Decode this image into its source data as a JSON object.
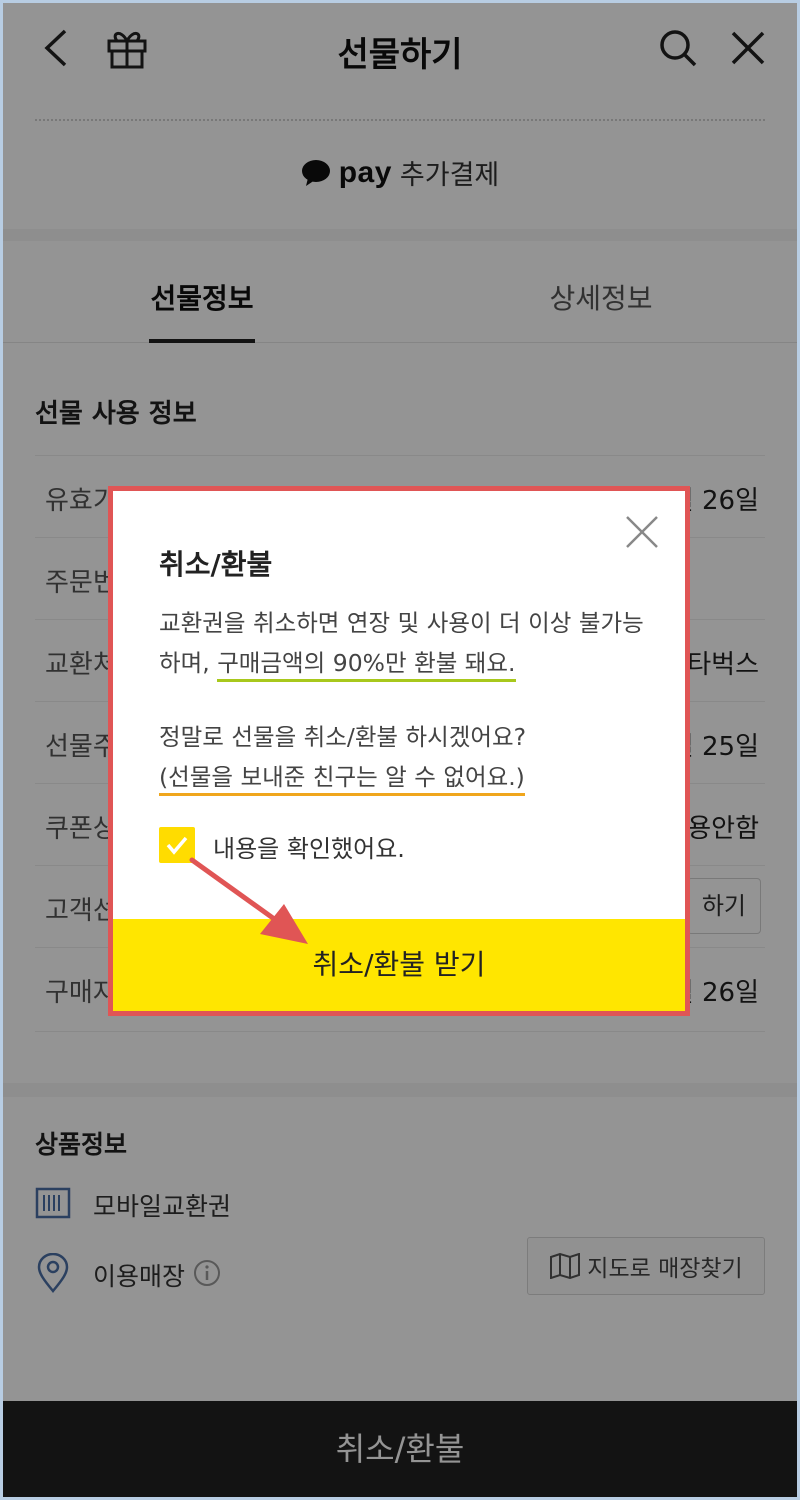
{
  "header": {
    "title": "선물하기",
    "icons": [
      "back-icon",
      "gift-icon",
      "search-icon",
      "close-icon"
    ]
  },
  "pay": {
    "logo": "pay",
    "label": "추가결제"
  },
  "tabs": [
    {
      "label": "선물정보",
      "active": true
    },
    {
      "label": "상세정보",
      "active": false
    }
  ],
  "usage_section": {
    "title": "선물 사용 정보",
    "rows": [
      {
        "label": "유효기",
        "value": "월 26일"
      },
      {
        "label": "주문번",
        "value": ""
      },
      {
        "label": "교환처",
        "value": "타벅스"
      },
      {
        "label": "선물주",
        "value": "일 25일"
      },
      {
        "label": "쿠폰상",
        "value": "용안함"
      },
      {
        "label": "고객선",
        "button": "하기"
      },
      {
        "label": "구매자",
        "value": "월 26일"
      }
    ]
  },
  "product_section": {
    "title": "상품정보",
    "item_type": "모바일교환권",
    "store_label": "이용매장",
    "map_button": "지도로 매장찾기"
  },
  "bottom_bar": {
    "label": "취소/환불"
  },
  "modal": {
    "title": "취소/환불",
    "line1": "교환권을 취소하면 연장 및 사용이 더 이상 불가능",
    "line2_prefix": "하며, ",
    "line2_highlight": "구매금액의 90%만 환불 돼요.",
    "line3": "정말로 선물을 취소/환불 하시겠어요?",
    "line4_highlight": "(선물을 보내준 친구는 알 수 없어요.)",
    "checkbox_label": "내용을 확인했어요.",
    "checkbox_checked": true,
    "confirm_button": "취소/환불 받기"
  },
  "colors": {
    "accent_yellow": "#ffe600",
    "checkbox_yellow": "#ffdc00",
    "highlight_green": "#a8c81c",
    "highlight_orange": "#f0a61c",
    "annotation_red": "#e05555",
    "bottom_bar": "#222222"
  }
}
